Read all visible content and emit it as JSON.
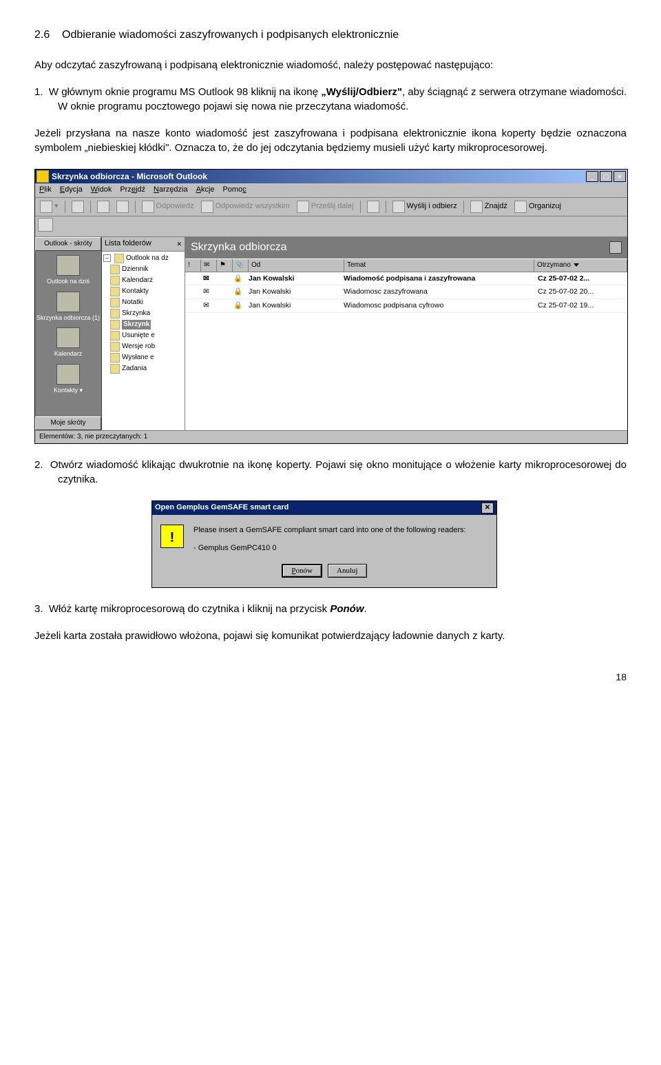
{
  "section_no": "2.6",
  "section_title": "Odbieranie wiadomości zaszyfrowanych i podpisanych elektronicznie",
  "intro": "Aby odczytać zaszyfrowaną i podpisaną elektronicznie wiadomość, należy postępować następująco:",
  "step1_no": "1.",
  "step1a": "W głównym oknie programu MS Outlook 98 kliknij na ikonę ",
  "step1b": "„Wyślij/Odbierz\"",
  "step1c": ", aby ściągnąć z serwera otrzymane wiadomości. W oknie programu pocztowego pojawi się nowa nie przeczytana wiadomość.",
  "para2": "Jeżeli przysłana na nasze konto wiadomość jest zaszyfrowana i podpisana elektronicznie ikona koperty będzie oznaczona symbolem „niebieskiej kłódki\". Oznacza to, że do jej odczytania będziemy musieli użyć karty mikroprocesorowej.",
  "outlook": {
    "title": "Skrzynka odbiorcza - Microsoft Outlook",
    "win_min": "_",
    "win_max": "▢",
    "win_close": "✕",
    "menu": [
      "Plik",
      "Edycja",
      "Widok",
      "Przejdź",
      "Narzędzia",
      "Akcje",
      "Pomoc"
    ],
    "tool": {
      "reply": "Odpowiedz",
      "replyall": "Odpowiedz wszystkim",
      "forward": "Prześlij dalej",
      "sendrecv": "Wyślij i odbierz",
      "find": "Znajdź",
      "organize": "Organizuj"
    },
    "shortcuts_head": "Outlook - skróty",
    "shortcuts": [
      "Outlook na dziś",
      "Skrzynka odbiorcza (1)",
      "Kalendarz",
      "Kontakty"
    ],
    "shortcuts_more": "Moje skróty",
    "folders_head": "Lista folderów",
    "folders_close": "✕",
    "folders": {
      "root": "Outlook na dz",
      "items": [
        "Dziennik",
        "Kalendarz",
        "Kontakty",
        "Notatki",
        "Skrzynka",
        "Skrzynk",
        "Usunięte e",
        "Wersje rob",
        "Wysłane e",
        "Zadania"
      ]
    },
    "main_head": "Skrzynka odbiorcza",
    "cols": {
      "flag": "!",
      "att": "",
      "lock": "",
      "from": "Od",
      "subject": "Temat",
      "received": "Otrzymano"
    },
    "rows": [
      {
        "lock": "🔒",
        "from": "Jan Kowalski",
        "subject": "Wiadomość podpisana i zaszyfrowana",
        "date": "Cz 25-07-02 2...",
        "bold": true
      },
      {
        "lock": "🔒",
        "from": "Jan Kowalski",
        "subject": "Wiadomosc zaszyfrowana",
        "date": "Cz 25-07-02 20..."
      },
      {
        "lock": "🔒",
        "from": "Jan Kowalski",
        "subject": "Wiadomosc podpisana cyfrowo",
        "date": "Cz 25-07-02 19..."
      }
    ],
    "status": "Elementów: 3, nie przeczytanych: 1"
  },
  "step2_no": "2.",
  "step2": "Otwórz wiadomość klikając dwukrotnie na ikonę koperty. Pojawi się okno monitujące o włożenie karty mikroprocesorowej do czytnika.",
  "dialog": {
    "title": "Open Gemplus GemSAFE smart card",
    "close": "✕",
    "line1": "Please insert a GemSAFE compliant smart card into one of the following readers:",
    "line2": "- Gemplus GemPC410 0",
    "btn_retry": "Ponów",
    "btn_cancel": "Anuluj"
  },
  "step3_no": "3.",
  "step3a": "Włóż kartę mikroprocesorową do czytnika i kliknij na przycisk ",
  "step3b": "Ponów",
  "step3c": ".",
  "para_last": "Jeżeli karta została prawidłowo włożona, pojawi się komunikat potwierdzający ładownie danych z karty.",
  "page_no": "18"
}
